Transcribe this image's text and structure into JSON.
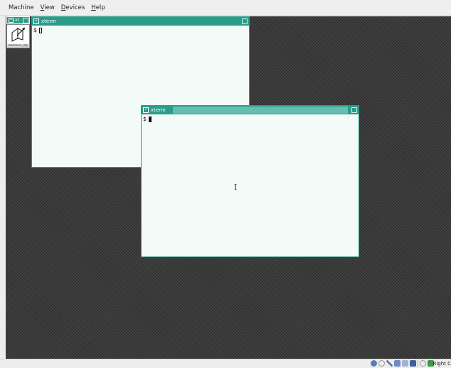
{
  "menubar": {
    "items": [
      {
        "label": "Machine"
      },
      {
        "label": "View",
        "accel": "V",
        "rest": "iew"
      },
      {
        "label": "Devices",
        "accel": "D",
        "rest": "evices"
      },
      {
        "label": "Help",
        "accel": "H",
        "rest": "elp"
      }
    ]
  },
  "icon_manager": {
    "title": "xt",
    "icon_label": "baseline_bg"
  },
  "window1": {
    "title": "xterm",
    "prompt": "$"
  },
  "window2": {
    "title": "xterm",
    "prompt": "$"
  },
  "statusbar": {
    "host_key_label": "Right C"
  },
  "colors": {
    "title_bar": "#2a9c88",
    "terminal_bg": "#f3fbf8",
    "desktop": "#3a3a3a"
  }
}
